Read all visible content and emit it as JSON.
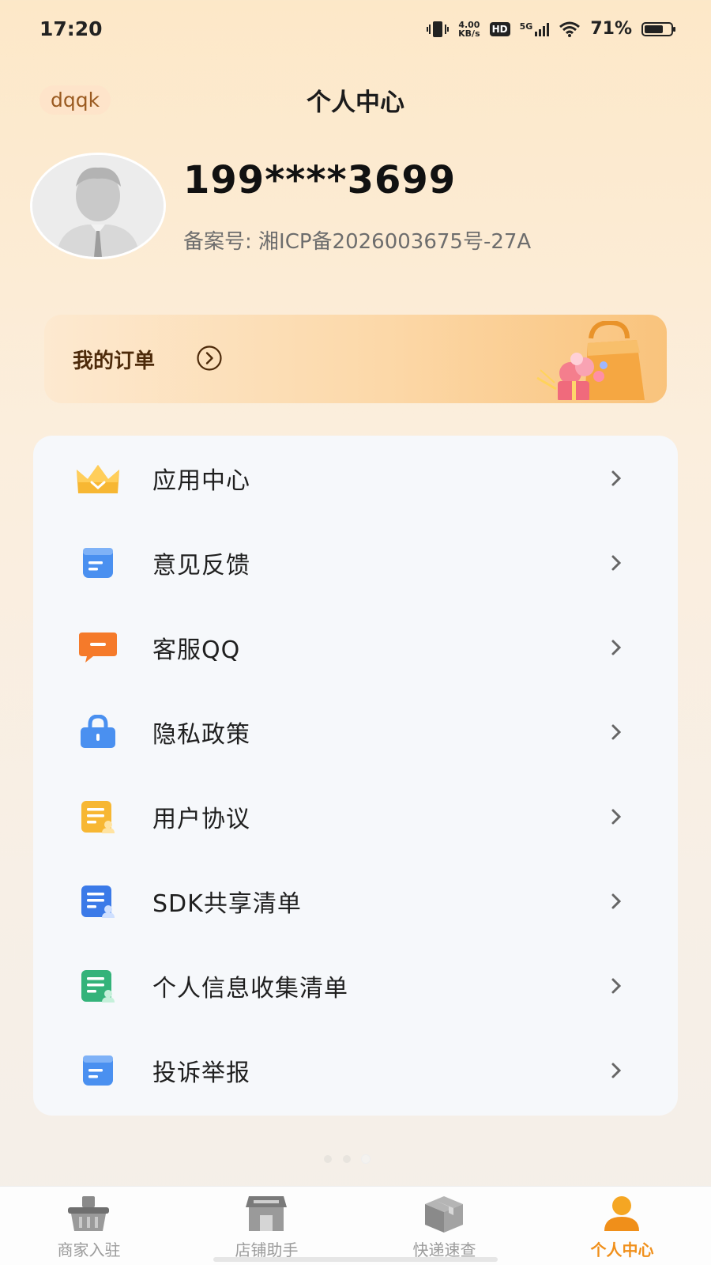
{
  "status_bar": {
    "time": "17:20",
    "net_speed_value": "4.00",
    "net_speed_unit": "KB/s",
    "hd": "HD",
    "network": "5G",
    "battery_percent": "71%",
    "battery_level": 0.71,
    "icons": [
      "vibrate-icon",
      "hd-icon",
      "signal-icon",
      "wifi-icon",
      "battery-icon"
    ]
  },
  "header": {
    "tag": "dqqk",
    "title": "个人中心"
  },
  "profile": {
    "phone": "199****3699",
    "icp": "备案号: 湘ICP备2026003675号-27A",
    "avatar_icon": "default-avatar-icon"
  },
  "orders": {
    "label": "我的订单",
    "arrow_icon": "circle-arrow-icon",
    "illustration": "shopping-bag-illustration"
  },
  "menu": {
    "items": [
      {
        "label": "应用中心",
        "icon": "crown-icon",
        "color": "#f7b733"
      },
      {
        "label": "意见反馈",
        "icon": "document-icon",
        "color": "#4a90f0"
      },
      {
        "label": "客服QQ",
        "icon": "chat-icon",
        "color": "#f57a2a"
      },
      {
        "label": "隐私政策",
        "icon": "lock-icon",
        "color": "#4a90f0"
      },
      {
        "label": "用户协议",
        "icon": "agreement-icon",
        "color": "#f7b733"
      },
      {
        "label": "SDK共享清单",
        "icon": "list-user-icon",
        "color": "#3b7ae8"
      },
      {
        "label": "个人信息收集清单",
        "icon": "info-list-icon",
        "color": "#34b37a"
      },
      {
        "label": "投诉举报",
        "icon": "report-icon",
        "color": "#4a90f0"
      }
    ]
  },
  "pager": {
    "count": 3,
    "active": 3
  },
  "tabs": [
    {
      "label": "商家入驻",
      "icon": "basket-icon",
      "active": false
    },
    {
      "label": "店铺助手",
      "icon": "store-icon",
      "active": false
    },
    {
      "label": "快递速查",
      "icon": "package-icon",
      "active": false
    },
    {
      "label": "个人中心",
      "icon": "person-icon",
      "active": true
    }
  ],
  "colors": {
    "accent": "#f08f1a",
    "inactive_tab": "#9b9b9b",
    "card_bg": "#f6f8fb"
  }
}
